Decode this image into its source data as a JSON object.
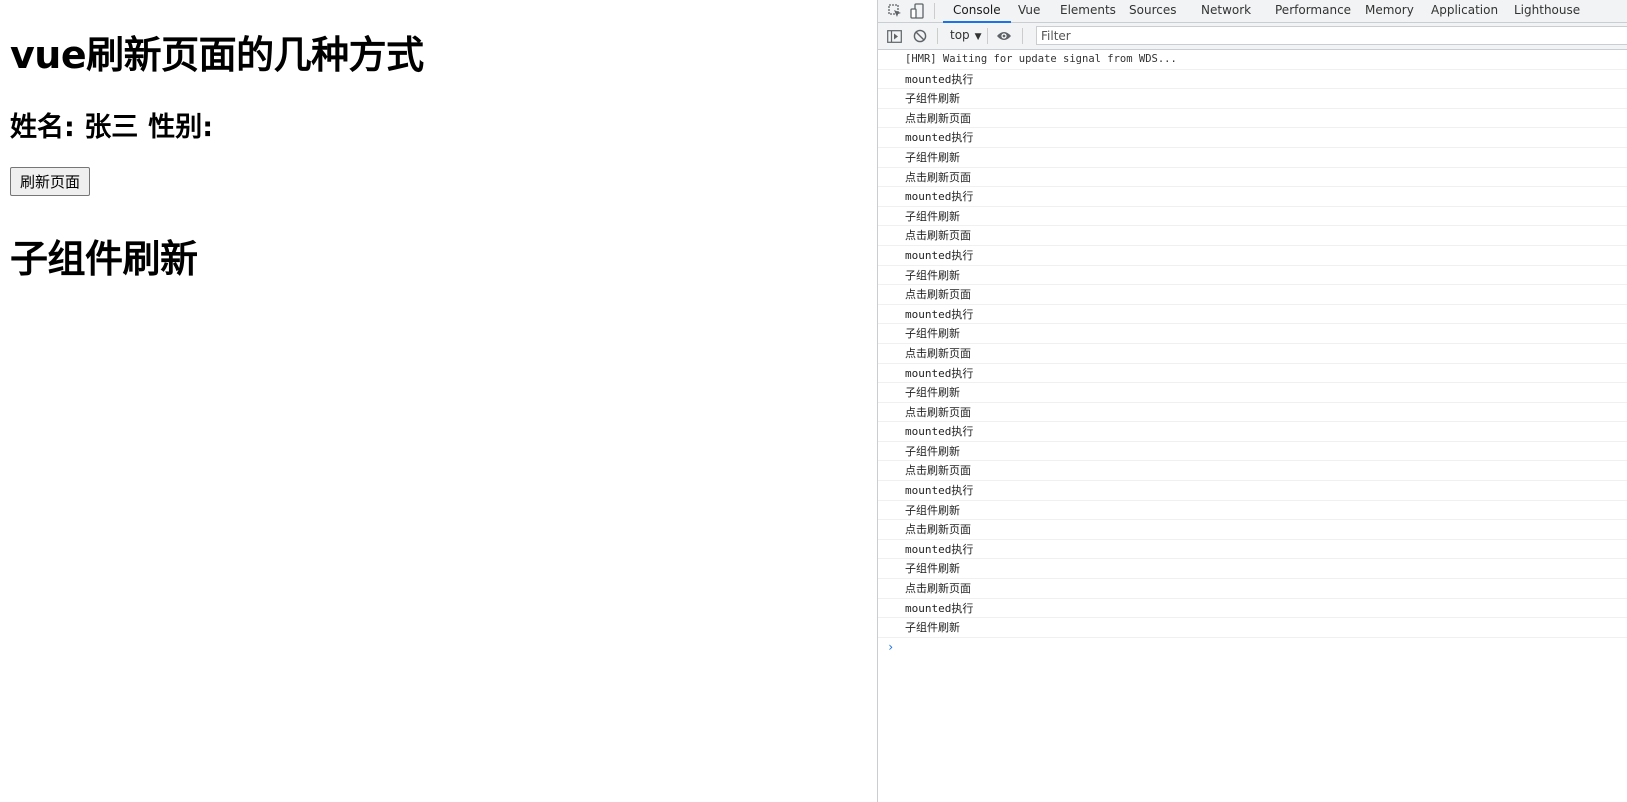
{
  "page": {
    "title": "vue刷新页面的几种方式",
    "name_label": "姓名: 张三",
    "gender_label": "性别:",
    "refresh_button": "刷新页面",
    "child_text": "子组件刷新"
  },
  "devtools": {
    "icons": [
      "inspect-element-icon",
      "device-toggle-icon"
    ],
    "tabs": [
      "Console",
      "Vue",
      "Elements",
      "Sources",
      "Network",
      "Performance",
      "Memory",
      "Application",
      "Lighthouse"
    ],
    "active_tab": "Console",
    "context": "top",
    "filter_placeholder": "Filter",
    "accent_color": "#1a73e8",
    "console_lines": [
      "[HMR] Waiting for update signal from WDS...",
      "mounted执行",
      "子组件刷新",
      "点击刷新页面",
      "mounted执行",
      "子组件刷新",
      "点击刷新页面",
      "mounted执行",
      "子组件刷新",
      "点击刷新页面",
      "mounted执行",
      "子组件刷新",
      "点击刷新页面",
      "mounted执行",
      "子组件刷新",
      "点击刷新页面",
      "mounted执行",
      "子组件刷新",
      "点击刷新页面",
      "mounted执行",
      "子组件刷新",
      "点击刷新页面",
      "mounted执行",
      "子组件刷新",
      "点击刷新页面",
      "mounted执行",
      "子组件刷新",
      "点击刷新页面",
      "mounted执行",
      "子组件刷新"
    ],
    "prompt_symbol": "›"
  }
}
